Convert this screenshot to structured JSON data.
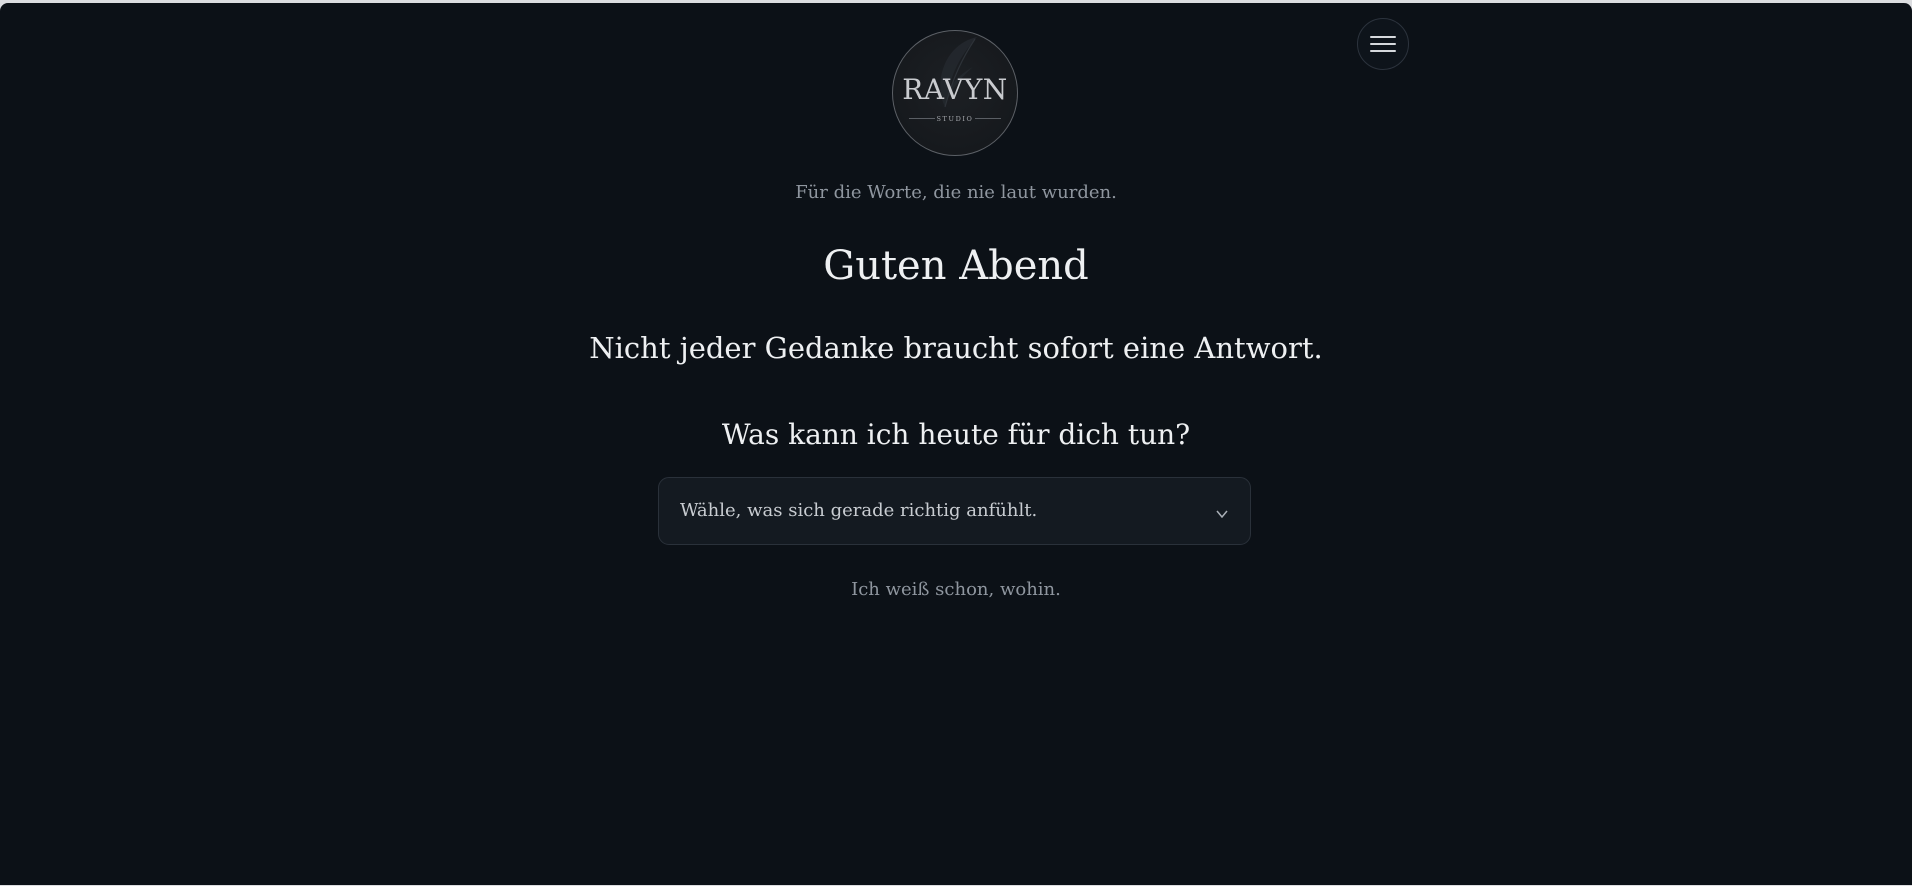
{
  "brand": {
    "name": "RAVYN",
    "sub": "STUDIO",
    "logo_icon": "feather-icon"
  },
  "header": {
    "menu_icon": "hamburger-menu-icon"
  },
  "main": {
    "tagline": "Für die Worte, die nie laut wurden.",
    "greeting": "Guten Abend",
    "subline": "Nicht jeder Gedanke braucht sofort eine Antwort.",
    "question": "Was kann ich heute für dich tun?",
    "select": {
      "value": "Wähle, was sich gerade richtig anfühlt.",
      "chevron_icon": "chevron-down-icon"
    },
    "alt_link": "Ich weiß schon, wohin."
  },
  "colors": {
    "background": "#0c1117",
    "text_primary": "#eef0f2",
    "text_muted": "#8f969f",
    "field_background": "#141a21"
  }
}
